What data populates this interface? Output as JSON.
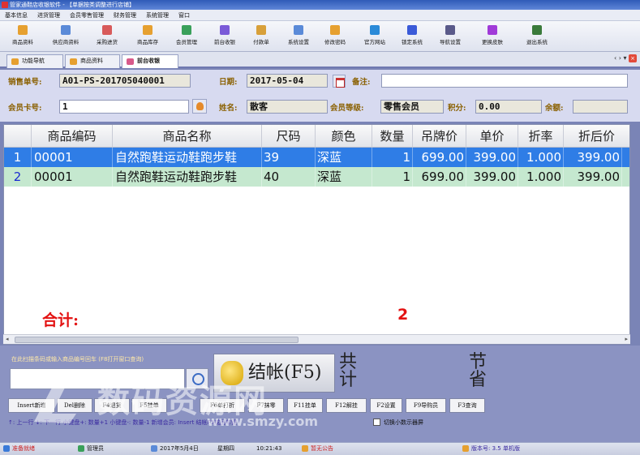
{
  "window": {
    "title": "管家通鞋店收银软件 - 【单据按类调整进行店铺】"
  },
  "menu": [
    "基本信息",
    "进货管理",
    "会员零售管理",
    "财务管理",
    "系统管理",
    "窗口"
  ],
  "toolbar": [
    {
      "label": "商品资料",
      "icon": "product-icon",
      "color": "#e6a030"
    },
    {
      "label": "供应商资料",
      "icon": "supplier-icon",
      "color": "#5a8ad8"
    },
    {
      "label": "采购进货",
      "icon": "purchase-icon",
      "color": "#d85a5a"
    },
    {
      "label": "商品库存",
      "icon": "inventory-icon",
      "color": "#e6a030"
    },
    {
      "label": "会员管理",
      "icon": "member-icon",
      "color": "#3aa05a"
    },
    {
      "label": "前台收银",
      "icon": "cashier-icon",
      "color": "#7a5ad8"
    },
    {
      "label": "付款单",
      "icon": "payment-icon",
      "color": "#d8a03a"
    },
    {
      "label": "系统设置",
      "icon": "settings-icon",
      "color": "#5a8ad8"
    },
    {
      "label": "修改密码",
      "icon": "password-icon",
      "color": "#e6a030"
    },
    {
      "label": "官方网站",
      "icon": "website-icon",
      "color": "#2a8ad8"
    },
    {
      "label": "锁定系统",
      "icon": "lock-icon",
      "color": "#3a5ad8"
    },
    {
      "label": "导航设置",
      "icon": "navigation-icon",
      "color": "#5a5a8a"
    },
    {
      "label": "更换皮肤",
      "icon": "skin-icon",
      "color": "#a03ad8"
    },
    {
      "label": "退出系统",
      "icon": "exit-icon",
      "color": "#3a7a3a"
    }
  ],
  "tabs": [
    {
      "label": "功能导航",
      "color": "#e6a030"
    },
    {
      "label": "商品资料",
      "color": "#e6a030"
    },
    {
      "label": "前台收银",
      "color": "#d85a8a"
    }
  ],
  "tab_controls": "‹ › ▾",
  "tab_close": "×",
  "form": {
    "order_no_label": "销售单号:",
    "order_no": "A01-PS-201705040001",
    "date_label": "日期:",
    "date": "2017-05-04",
    "remark_label": "备注:",
    "remark": "",
    "member_card_label": "会员卡号:",
    "member_card": "1",
    "name_label": "姓名:",
    "name": "散客",
    "level_label": "会员等级:",
    "level": "零售会员",
    "points_label": "积分:",
    "points": "0.00",
    "balance_label": "余额:",
    "balance": ""
  },
  "table": {
    "columns": [
      "商品编码",
      "商品名称",
      "尺码",
      "颜色",
      "数量",
      "吊牌价",
      "单价",
      "折率",
      "折后价"
    ],
    "rows": [
      {
        "n": "1",
        "code": "00001",
        "name": "自然跑鞋运动鞋跑步鞋",
        "size": "39",
        "color": "深蓝",
        "qty": "1",
        "tag_price": "699.00",
        "price": "399.00",
        "rate": "1.000",
        "final": "399.00"
      },
      {
        "n": "2",
        "code": "00001",
        "name": "自然跑鞋运动鞋跑步鞋",
        "size": "40",
        "color": "深蓝",
        "qty": "1",
        "tag_price": "699.00",
        "price": "399.00",
        "rate": "1.000",
        "final": "399.00"
      }
    ]
  },
  "summary": {
    "total_label": "合计:",
    "total_qty": "2"
  },
  "bottom": {
    "hint": "在此扫描条码或输入商品编号回车 (F8打开窗口查询)",
    "checkout": "结帐(F5)",
    "total_count": "共计",
    "save": "节省",
    "fkeys": [
      "Insert新增",
      "Del删除",
      "F4退货",
      "F5挂单",
      "F6单打折",
      "F7抹零",
      "F11挂单",
      "F12解挂",
      "F2设置",
      "F9导购员",
      "F3查询"
    ],
    "shortcut_hint": "↑: 上一行   ↓: 下一行   小键盘+: 数量+1   小键盘-: 数量-1   新增会员: Insert   结帐F5或回车键",
    "checkbox_label": "切换小数示器屏"
  },
  "status": {
    "ready": "准备就绪",
    "user": "管理员",
    "date": "2017年5月4日",
    "weekday": "星期四",
    "time": "10:21:43",
    "notice": "暂无公告",
    "version": "版本号: 3.5 单机版"
  },
  "watermark": {
    "text": "数码资源网",
    "url": "www.smzy.com"
  }
}
